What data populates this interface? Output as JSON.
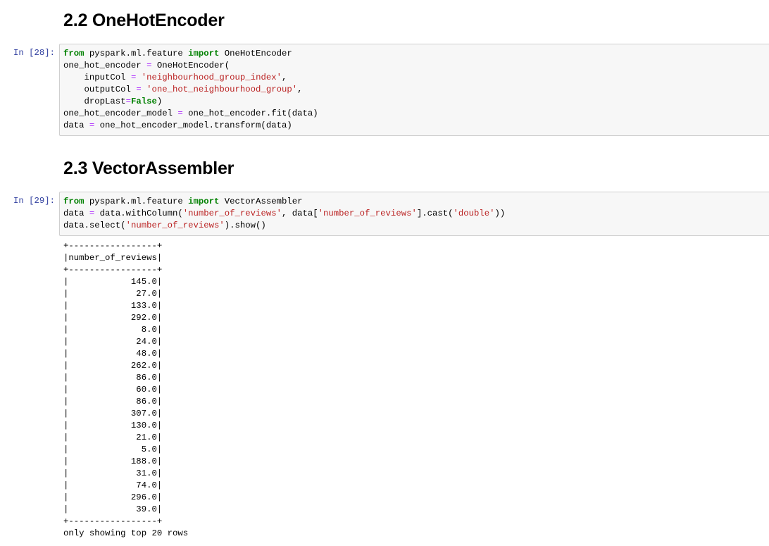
{
  "cells": [
    {
      "heading": "2.2 OneHotEncoder",
      "prompt": "In [28]:",
      "code_lines": [
        [
          {
            "t": "from",
            "c": "kw"
          },
          {
            "t": " pyspark.ml.feature ",
            "c": ""
          },
          {
            "t": "import",
            "c": "kw"
          },
          {
            "t": " OneHotEncoder",
            "c": ""
          }
        ],
        [
          {
            "t": "one_hot_encoder ",
            "c": ""
          },
          {
            "t": "=",
            "c": "op"
          },
          {
            "t": " OneHotEncoder(",
            "c": ""
          }
        ],
        [
          {
            "t": "    inputCol ",
            "c": ""
          },
          {
            "t": "=",
            "c": "op"
          },
          {
            "t": " ",
            "c": ""
          },
          {
            "t": "'neighbourhood_group_index'",
            "c": "st"
          },
          {
            "t": ",",
            "c": ""
          }
        ],
        [
          {
            "t": "    outputCol ",
            "c": ""
          },
          {
            "t": "=",
            "c": "op"
          },
          {
            "t": " ",
            "c": ""
          },
          {
            "t": "'one_hot_neighbourhood_group'",
            "c": "st"
          },
          {
            "t": ",",
            "c": ""
          }
        ],
        [
          {
            "t": "    dropLast",
            "c": ""
          },
          {
            "t": "=",
            "c": "op"
          },
          {
            "t": "False",
            "c": "kw"
          },
          {
            "t": ")",
            "c": ""
          }
        ],
        [
          {
            "t": "one_hot_encoder_model ",
            "c": ""
          },
          {
            "t": "=",
            "c": "op"
          },
          {
            "t": " one_hot_encoder.fit(data)",
            "c": ""
          }
        ],
        [
          {
            "t": "data ",
            "c": ""
          },
          {
            "t": "=",
            "c": "op"
          },
          {
            "t": " one_hot_encoder_model.transform(data)",
            "c": ""
          }
        ]
      ]
    },
    {
      "heading": "2.3 VectorAssembler",
      "prompt": "In [29]:",
      "code_lines": [
        [
          {
            "t": "from",
            "c": "kw"
          },
          {
            "t": " pyspark.ml.feature ",
            "c": ""
          },
          {
            "t": "import",
            "c": "kw"
          },
          {
            "t": " VectorAssembler",
            "c": ""
          }
        ],
        [
          {
            "t": "data ",
            "c": ""
          },
          {
            "t": "=",
            "c": "op"
          },
          {
            "t": " data.withColumn(",
            "c": ""
          },
          {
            "t": "'number_of_reviews'",
            "c": "st"
          },
          {
            "t": ", data[",
            "c": ""
          },
          {
            "t": "'number_of_reviews'",
            "c": "st"
          },
          {
            "t": "].cast(",
            "c": ""
          },
          {
            "t": "'double'",
            "c": "st"
          },
          {
            "t": "))",
            "c": ""
          }
        ],
        [
          {
            "t": "data.select(",
            "c": ""
          },
          {
            "t": "'number_of_reviews'",
            "c": "st"
          },
          {
            "t": ").show()",
            "c": ""
          }
        ]
      ]
    }
  ],
  "output": {
    "border": "+-----------------+",
    "header": "|number_of_reviews|",
    "values": [
      "145.0",
      "27.0",
      "133.0",
      "292.0",
      "8.0",
      "24.0",
      "48.0",
      "262.0",
      "86.0",
      "60.0",
      "86.0",
      "307.0",
      "130.0",
      "21.0",
      "5.0",
      "188.0",
      "31.0",
      "74.0",
      "296.0",
      "39.0"
    ],
    "footer": "only showing top 20 rows"
  }
}
